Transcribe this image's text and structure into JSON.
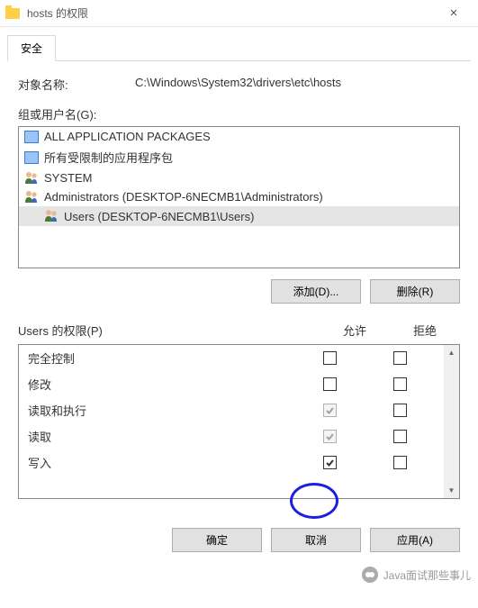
{
  "window": {
    "title": "hosts 的权限",
    "close_label": "×"
  },
  "tabs": [
    {
      "label": "安全"
    }
  ],
  "object_name": {
    "label": "对象名称:",
    "value": "C:\\Windows\\System32\\drivers\\etc\\hosts"
  },
  "groups": {
    "label": "组或用户名(G):",
    "items": [
      {
        "icon": "package-icon",
        "label": "ALL APPLICATION PACKAGES",
        "selected": false
      },
      {
        "icon": "package-icon",
        "label": "所有受限制的应用程序包",
        "selected": false
      },
      {
        "icon": "users-icon",
        "label": "SYSTEM",
        "selected": false
      },
      {
        "icon": "users-icon",
        "label": "Administrators (DESKTOP-6NECMB1\\Administrators)",
        "selected": false
      },
      {
        "icon": "users-icon",
        "label": "Users (DESKTOP-6NECMB1\\Users)",
        "selected": true
      }
    ],
    "add_label": "添加(D)...",
    "remove_label": "删除(R)"
  },
  "permissions": {
    "header_label": "Users 的权限(P)",
    "allow_label": "允许",
    "deny_label": "拒绝",
    "rows": [
      {
        "name": "完全控制",
        "allow": false,
        "allow_disabled": false,
        "deny": false
      },
      {
        "name": "修改",
        "allow": false,
        "allow_disabled": false,
        "deny": false
      },
      {
        "name": "读取和执行",
        "allow": true,
        "allow_disabled": true,
        "deny": false
      },
      {
        "name": "读取",
        "allow": true,
        "allow_disabled": true,
        "deny": false
      },
      {
        "name": "写入",
        "allow": true,
        "allow_disabled": false,
        "deny": false
      }
    ]
  },
  "footer": {
    "ok_label": "确定",
    "cancel_label": "取消",
    "apply_label": "应用(A)"
  },
  "watermark": {
    "text": "Java面试那些事儿"
  }
}
